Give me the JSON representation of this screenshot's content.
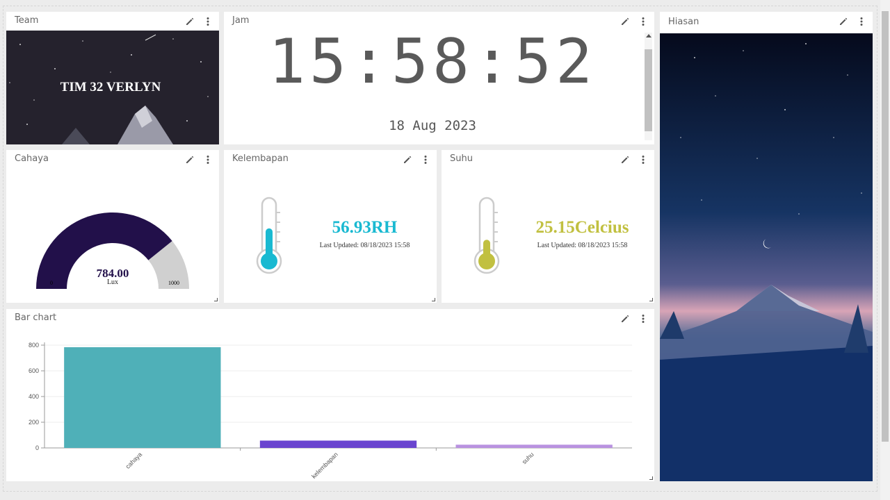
{
  "widgets": {
    "team": {
      "title": "Team",
      "banner_text": "TIM 32 VERLYN"
    },
    "jam": {
      "title": "Jam",
      "time": "15:58:52",
      "date": "18 Aug 2023"
    },
    "hiasan": {
      "title": "Hiasan"
    },
    "cahaya": {
      "title": "Cahaya",
      "value": "784.00",
      "unit": "Lux",
      "min": "0",
      "max": "1000",
      "fraction": 0.784
    },
    "kelembapan": {
      "title": "Kelembapan",
      "value": "56.93RH",
      "updated": "Last Updated: 08/18/2023 15:58",
      "level": 0.55,
      "color": "#19b9d1"
    },
    "suhu": {
      "title": "Suhu",
      "value": "25.15Celcius",
      "updated": "Last Updated: 08/18/2023 15:58",
      "level": 0.35,
      "color": "#c1c040"
    },
    "bar_chart": {
      "title": "Bar chart"
    }
  },
  "icons": {
    "edit": "pencil-icon",
    "menu": "more-vertical-icon"
  },
  "colors": {
    "gauge_fill": "#22104a",
    "gauge_bg": "#d0d0d0"
  },
  "chart_data": {
    "type": "bar",
    "categories": [
      "cahaya",
      "kelembapan",
      "suhu"
    ],
    "values": [
      784,
      56.93,
      25.15
    ],
    "colors": [
      "#4fb0b8",
      "#6a45cf",
      "#b992e0"
    ],
    "yticks": [
      "0",
      "200",
      "400",
      "600",
      "800"
    ],
    "ylim": [
      0,
      800
    ],
    "title": "",
    "xlabel": "",
    "ylabel": ""
  }
}
